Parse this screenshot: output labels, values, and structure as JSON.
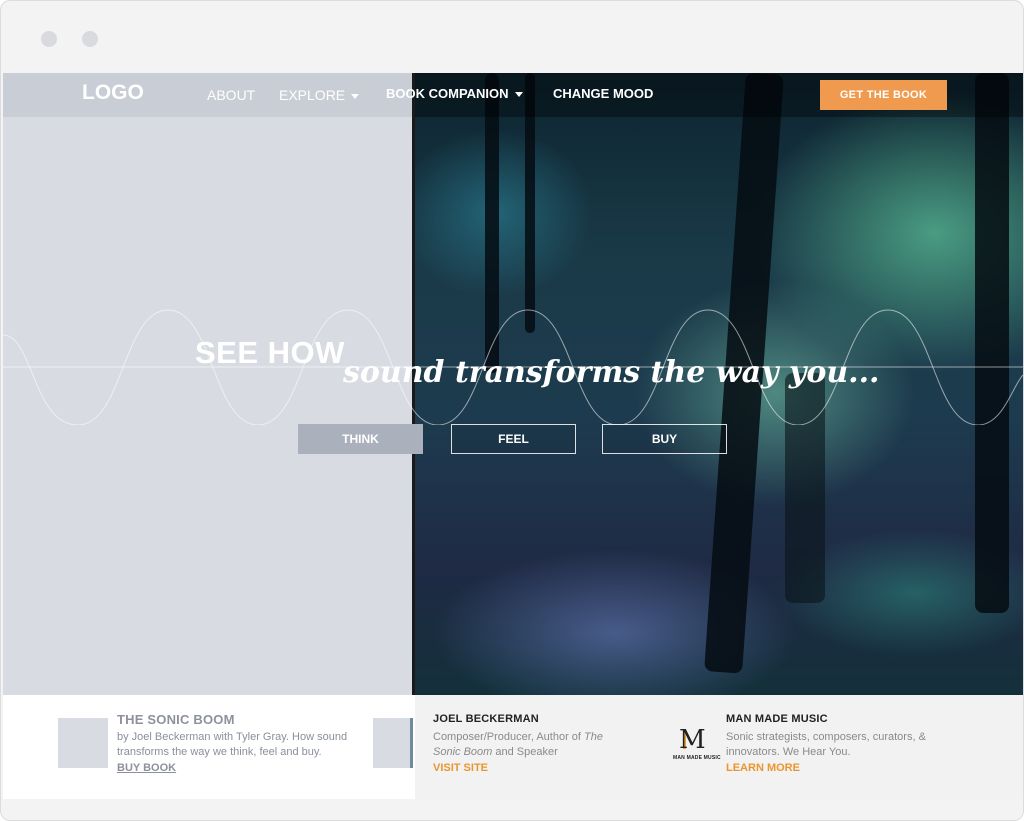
{
  "nav": {
    "logo": "LOGO",
    "about": "ABOUT",
    "explore": "EXPLORE",
    "book_companion": "BOOK COMPANION",
    "change_mood": "CHANGE MOOD",
    "cta": "GET THE BOOK"
  },
  "hero": {
    "see_how": "SEE HOW",
    "tagline": "sound transforms the way you...",
    "buttons": [
      "THINK",
      "FEEL",
      "BUY"
    ]
  },
  "footer": {
    "book": {
      "title": "THE SONIC BOOM",
      "text": "by Joel Beckerman with Tyler Gray. How sound transforms the way we think, feel and buy.",
      "link": "BUY BOOK"
    },
    "author": {
      "title": "JOEL BECKERMAN",
      "text_prefix": "Composer/Producer, Author of ",
      "text_book": "The Sonic Boom",
      "text_suffix": " and Speaker",
      "link": "VISIT SITE"
    },
    "company": {
      "title": "MAN MADE MUSIC",
      "text": "Sonic strategists, composers, curators, & innovators. We Hear You.",
      "link": "LEARN MORE",
      "logo_letter": "M",
      "logo_caption": "MAN MADE MUSIC"
    }
  },
  "colors": {
    "accent": "#ef9a4f",
    "link_orange": "#e9962e",
    "wire_bg": "#d8dbe2"
  }
}
